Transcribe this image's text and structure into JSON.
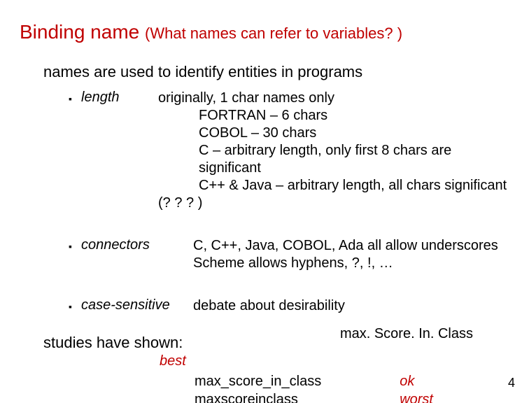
{
  "title": {
    "main": "Binding name",
    "sub": "(What names can refer to variables? )"
  },
  "intro": "names are used to identify entities in programs",
  "bullets": {
    "length": {
      "name": "length",
      "lead": "originally, 1 char names only",
      "lines": [
        "FORTRAN – 6 chars",
        "COBOL – 30 chars",
        "C – arbitrary length, only first 8 chars are significant",
        "C++ & Java – arbitrary length, all chars significant"
      ],
      "qmarks": "(? ? ? )"
    },
    "connectors": {
      "name": "connectors",
      "lines": [
        "C, C++, Java, COBOL, Ada all allow underscores",
        "Scheme allows hyphens, ?, !, …"
      ]
    },
    "casesensitive": {
      "name": "case-sensitive",
      "desc": "debate about desirability"
    }
  },
  "studies": "studies have shown:",
  "best_label": "best",
  "examples": {
    "left": [
      "max_score_in_class",
      "maxscoreinclass"
    ],
    "camel": "max. Score. In. Class",
    "right": [
      "ok",
      "worst"
    ]
  },
  "page": "4",
  "glyphs": {
    "square": "▪"
  }
}
